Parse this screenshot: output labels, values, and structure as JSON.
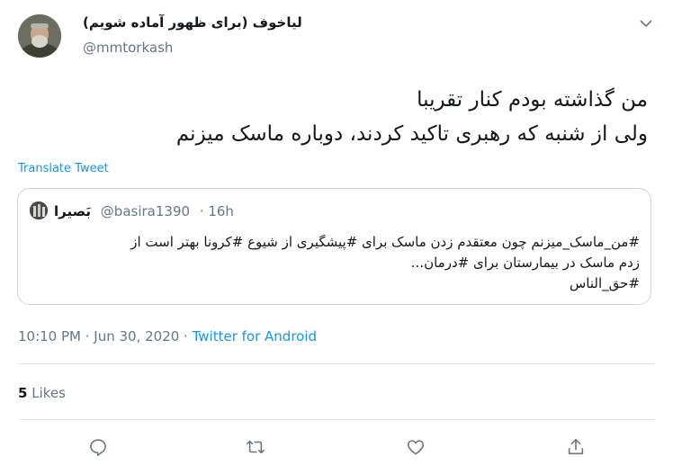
{
  "author": {
    "display_name": "لیاخوف (برای ظهور آماده شویم)",
    "handle": "@mmtorkash"
  },
  "tweet": {
    "lines": [
      "من گذاشته بودم کنار تقریبا",
      "ولی از شنبه که رهبری تاکید کردند، دوباره ماسک میزنم"
    ],
    "translate_label": "Translate Tweet"
  },
  "quoted": {
    "display_name": "بَصیرا",
    "handle": "@basira1390",
    "time": "· 16h",
    "lines": [
      "#من_ماسک_میزنم چون معتقدم زدن ماسک برای #پیشگیری از شیوع #کرونا بهتر است از",
      "زدم ماسک در بیمارستان برای #درمان...",
      "#حق_الناس"
    ]
  },
  "meta": {
    "time_date": "10:10 PM · Jun 30, 2020 · ",
    "source": "Twitter for Android"
  },
  "stats": {
    "likes_count": "5",
    "likes_label": "Likes"
  },
  "icons": {
    "reply": "reply-icon",
    "retweet": "retweet-icon",
    "like": "like-icon",
    "share": "share-icon",
    "caret": "chevron-down-icon"
  },
  "colors": {
    "link": "#1b95e0",
    "secondary_text": "#657786",
    "border": "#ccd6dd"
  }
}
